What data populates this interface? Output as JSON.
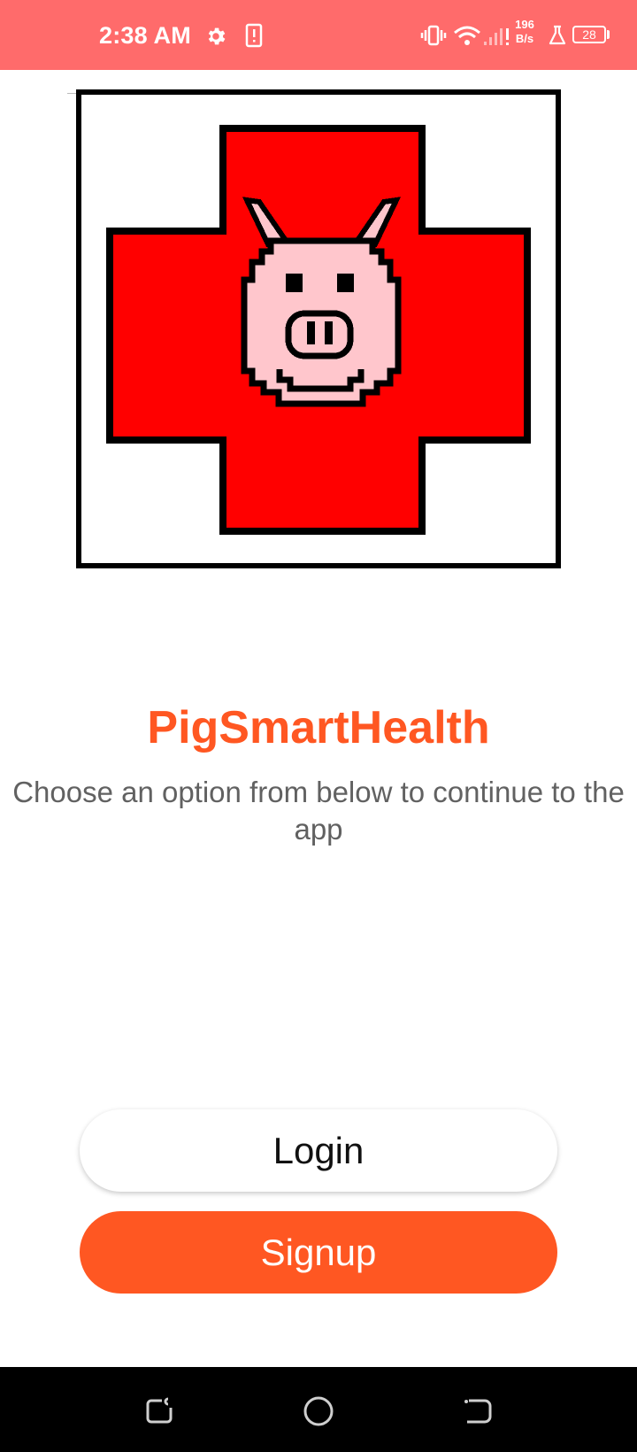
{
  "status_bar": {
    "time": "2:38 AM",
    "net_speed_value": "196",
    "net_speed_unit": "B/s",
    "battery_level": "28",
    "background_color": "#ff6b6b"
  },
  "logo": {
    "icon": "pig-red-cross-logo"
  },
  "welcome": {
    "title": "PigSmartHealth",
    "subtitle": "Choose an option from below to continue to the app",
    "title_color": "#ff5722"
  },
  "actions": {
    "login_label": "Login",
    "signup_label": "Signup",
    "signup_color": "#ff5722"
  },
  "nav_bar": {
    "icons": [
      "recent-apps-icon",
      "home-icon",
      "back-icon"
    ]
  }
}
